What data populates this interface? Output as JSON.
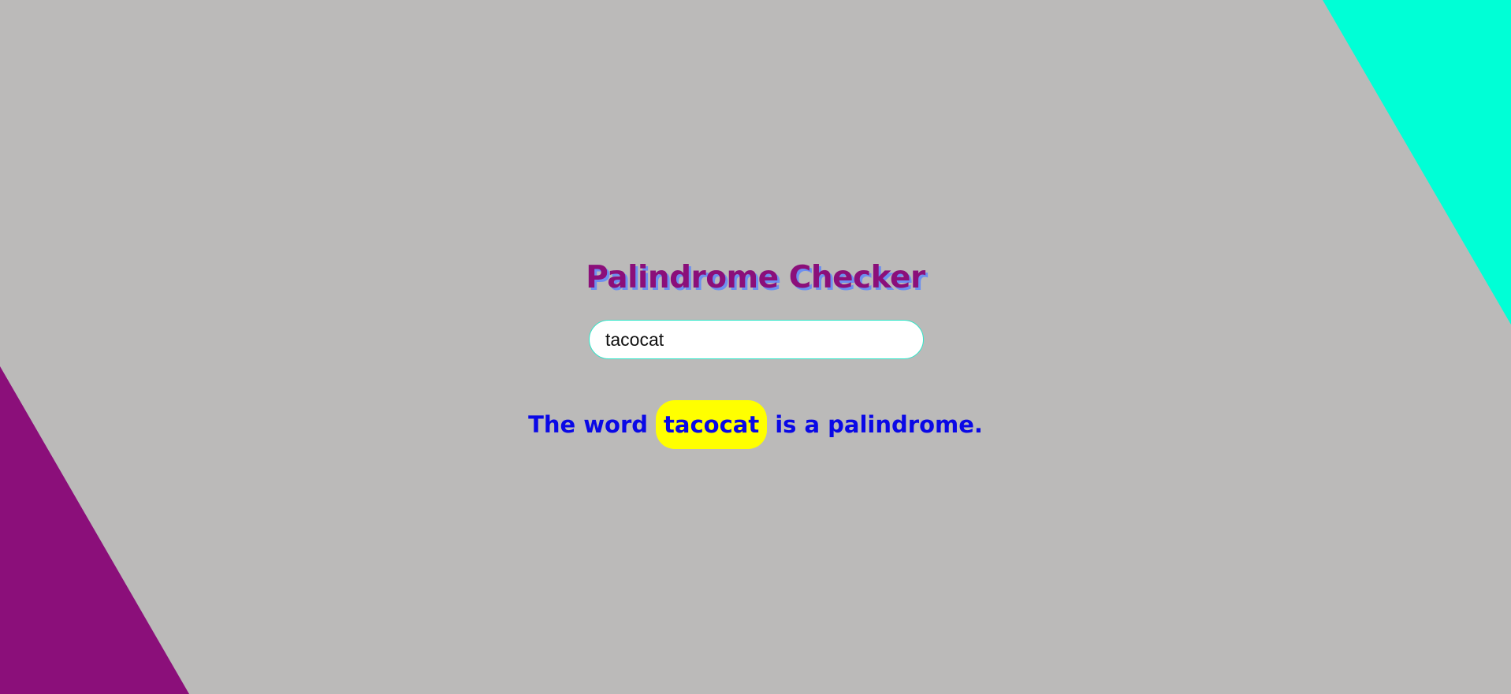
{
  "colors": {
    "background": "#bbbab9",
    "top_right_triangle": "#00ffd6",
    "bottom_left_triangle": "#8b0f7a",
    "title": "#8b0f7a",
    "title_shadow": "#6d8ff0",
    "result_text": "#0a08e6",
    "word_highlight": "#ffff00",
    "input_border": "#2fe6c8"
  },
  "header": {
    "title": "Palindrome Checker"
  },
  "input": {
    "value": "tacocat",
    "placeholder": ""
  },
  "result": {
    "prefix": "The word",
    "word": "tacocat",
    "suffix": "is a palindrome."
  }
}
